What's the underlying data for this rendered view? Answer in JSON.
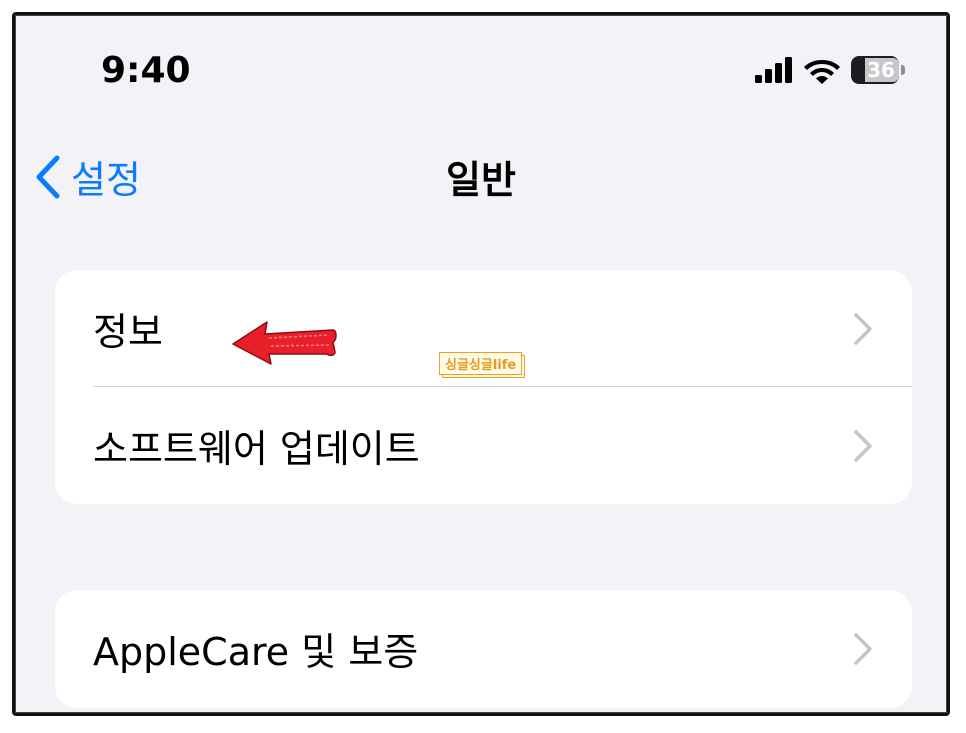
{
  "status_bar": {
    "time": "9:40",
    "battery_level": "36",
    "icons": [
      "cellular-signal-icon",
      "wifi-icon",
      "battery-icon"
    ]
  },
  "nav": {
    "back_label": "설정",
    "title": "일반"
  },
  "groups": [
    {
      "items": [
        {
          "label": "정보"
        },
        {
          "label": "소프트웨어 업데이트"
        }
      ]
    },
    {
      "items": [
        {
          "label": "AppleCare 및 보증"
        }
      ]
    }
  ],
  "annotation": {
    "arrow": "red-arrow-icon",
    "watermark": "싱글싱글life"
  },
  "colors": {
    "accent": "#0a7cff",
    "background": "#f2f2f7",
    "cell": "#ffffff",
    "arrow": "#e8202a",
    "watermark": "#f0a020"
  }
}
